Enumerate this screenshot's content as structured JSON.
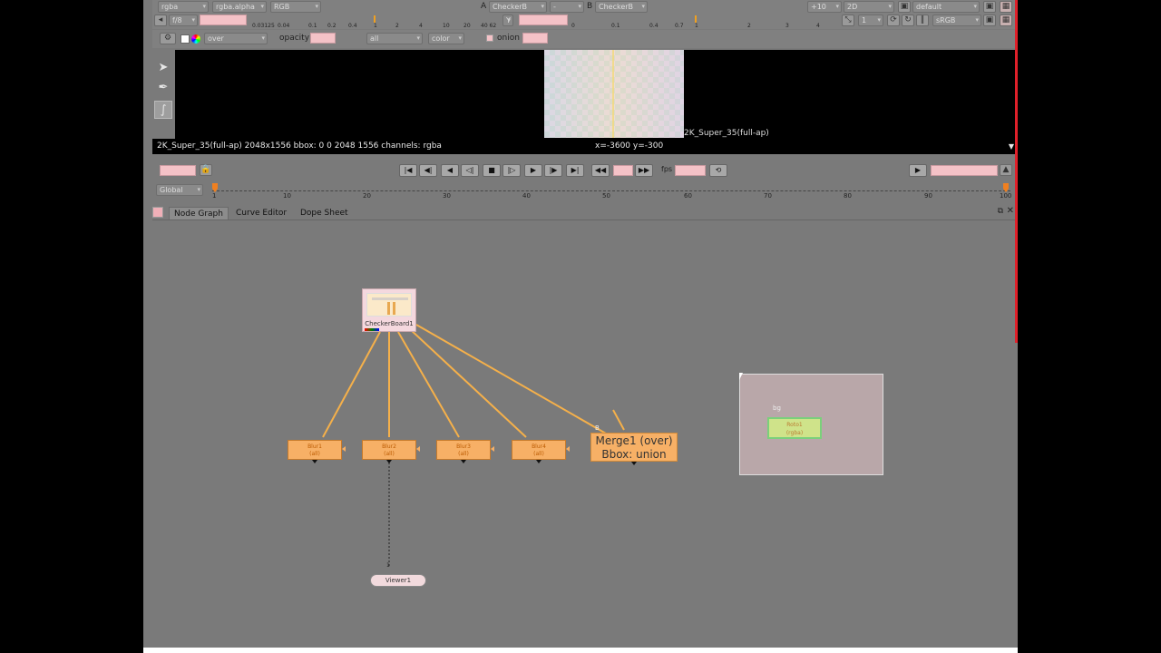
{
  "viewer_toolbar": {
    "channels": "rgba",
    "channel_alpha": "rgba.alpha",
    "display": "RGB",
    "input_a_label": "A",
    "input_a": "CheckerB",
    "compare_mode": "-",
    "input_b_label": "B",
    "input_b": "CheckerB",
    "gain_step": "+10",
    "view_mode": "2D",
    "lut": "default",
    "fstop": "f/8",
    "y_label": "Y",
    "gamma_ticks_left": [
      "0.03125",
      "0.04",
      "0.1",
      "0.2",
      "0.4",
      "1",
      "2",
      "4",
      "10",
      "20",
      "40 62"
    ],
    "gamma_ticks_right": [
      "0",
      "0.1",
      "0.4",
      "0.7",
      "1",
      "2",
      "3",
      "4"
    ],
    "proxy": "1",
    "colorspace": "sRGB",
    "wipe_mode": "over",
    "opacity_label": "opacity",
    "layers": "all",
    "wipe_channel": "color",
    "onion_label": "onion"
  },
  "viewer": {
    "format_label": "2K_Super_35(full-ap)",
    "status_left": "2K_Super_35(full-ap) 2048x1556 bbox: 0 0 2048 1556 channels: rgba",
    "status_coords": "x=-3600 y=-300"
  },
  "transport": {
    "fps_label": "fps",
    "timeline_scope": "Global",
    "timeline_numbers": [
      "1",
      "10",
      "20",
      "30",
      "40",
      "50",
      "60",
      "70",
      "80",
      "90",
      "100"
    ]
  },
  "tabs": [
    "Node Graph",
    "Curve Editor",
    "Dope Sheet"
  ],
  "nodes": {
    "checkerboard": "CheckerBoard1",
    "blur1": "Blur1",
    "blur2": "Blur2",
    "blur3": "Blur3",
    "blur4": "Blur4",
    "blur_sub": "(all)",
    "merge_title": "Merge1 (over)",
    "merge_sub": "Bbox: union",
    "merge_input_b": "B",
    "viewer": "Viewer1",
    "viewer_input": "1",
    "backdrop_node": "Roto1",
    "backdrop_node_sub": "(rgba)",
    "bg_label": "bg"
  },
  "colors": {
    "background": "#7a7a7a",
    "node_orange": "#f7b066",
    "edge": "#f5b04a",
    "accent_red": "#e0202a"
  }
}
